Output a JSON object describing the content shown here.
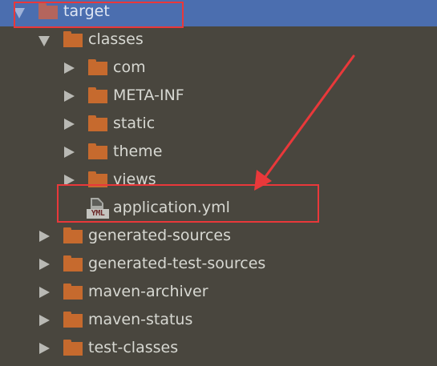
{
  "tree": {
    "items": [
      {
        "label": "target",
        "depth": 0,
        "expanded": true,
        "type": "folder",
        "selected": true
      },
      {
        "label": "classes",
        "depth": 1,
        "expanded": true,
        "type": "folder"
      },
      {
        "label": "com",
        "depth": 2,
        "expanded": false,
        "type": "folder"
      },
      {
        "label": "META-INF",
        "depth": 2,
        "expanded": false,
        "type": "folder"
      },
      {
        "label": "static",
        "depth": 2,
        "expanded": false,
        "type": "folder"
      },
      {
        "label": "theme",
        "depth": 2,
        "expanded": false,
        "type": "folder"
      },
      {
        "label": "views",
        "depth": 2,
        "expanded": false,
        "type": "folder"
      },
      {
        "label": "application.yml",
        "depth": 2,
        "type": "file",
        "icon_badge": "YML"
      },
      {
        "label": "generated-sources",
        "depth": 1,
        "expanded": false,
        "type": "folder"
      },
      {
        "label": "generated-test-sources",
        "depth": 1,
        "expanded": false,
        "type": "folder"
      },
      {
        "label": "maven-archiver",
        "depth": 1,
        "expanded": false,
        "type": "folder"
      },
      {
        "label": "maven-status",
        "depth": 1,
        "expanded": false,
        "type": "folder"
      },
      {
        "label": "test-classes",
        "depth": 1,
        "expanded": false,
        "type": "folder"
      }
    ]
  },
  "colors": {
    "background": "#49463e",
    "selection": "#4b6eaf",
    "folder": "#c66a2e",
    "annotation": "#e9383a",
    "text": "#d7d8d2"
  },
  "icons": {
    "folder": "folder-icon",
    "file": "yml-file-icon",
    "expand": "chevron-right-icon",
    "collapse": "chevron-down-icon"
  }
}
